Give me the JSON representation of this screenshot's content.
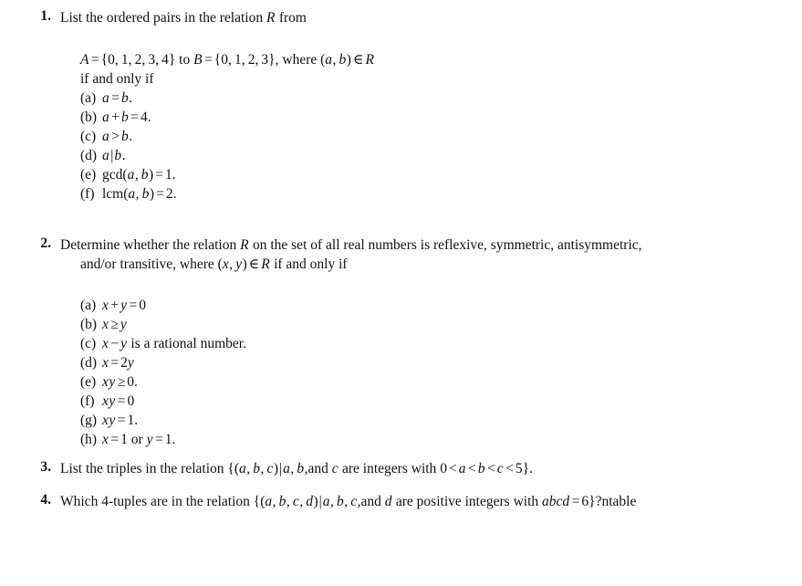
{
  "document": {
    "type": "math-exercise-sheet",
    "background_color": "#ffffff",
    "text_color": "#111111"
  },
  "problems": [
    {
      "number": "1.",
      "stem": "List the ordered pairs in the relation R from",
      "body_line_1": "A = {0, 1, 2, 3, 4} to B = {0, 1, 2, 3}, where (a, b) ∈ R",
      "body_line_2": "if and only if",
      "items": [
        {
          "label": "(a)",
          "text": "a = b."
        },
        {
          "label": "(b)",
          "text": "a + b = 4."
        },
        {
          "label": "(c)",
          "text": "a > b."
        },
        {
          "label": "(d)",
          "text": "a|b."
        },
        {
          "label": "(e)",
          "text": "gcd(a, b) = 1."
        },
        {
          "label": "(f)",
          "text": "lcm(a, b) = 2."
        }
      ]
    },
    {
      "number": "2.",
      "stem_line_1": "Determine whether the relation R on the set of all real numbers is reflexive, symmetric, antisymmetric,",
      "stem_line_2": "and/or transitive, where (x, y) ∈ R if and only if",
      "items": [
        {
          "label": "(a)",
          "text": "x + y = 0"
        },
        {
          "label": "(b)",
          "text": "x ≥ y"
        },
        {
          "label": "(c)",
          "text": "x − y is a rational number."
        },
        {
          "label": "(d)",
          "text": "x = 2y"
        },
        {
          "label": "(e)",
          "text": "xy ≥ 0."
        },
        {
          "label": "(f)",
          "text": "xy = 0"
        },
        {
          "label": "(g)",
          "text": "xy = 1."
        },
        {
          "label": "(h)",
          "text": "x = 1 or y = 1."
        }
      ]
    },
    {
      "number": "3.",
      "stem": "List the triples in the relation {(a, b, c)|a, b,and c are integers with 0 < a < b < c < 5}."
    },
    {
      "number": "4.",
      "stem": "Which 4-tuples are in the relation {(a, b, c, d)|a, b, c,and d are positive integers with abcd = 6}?ntable"
    }
  ]
}
